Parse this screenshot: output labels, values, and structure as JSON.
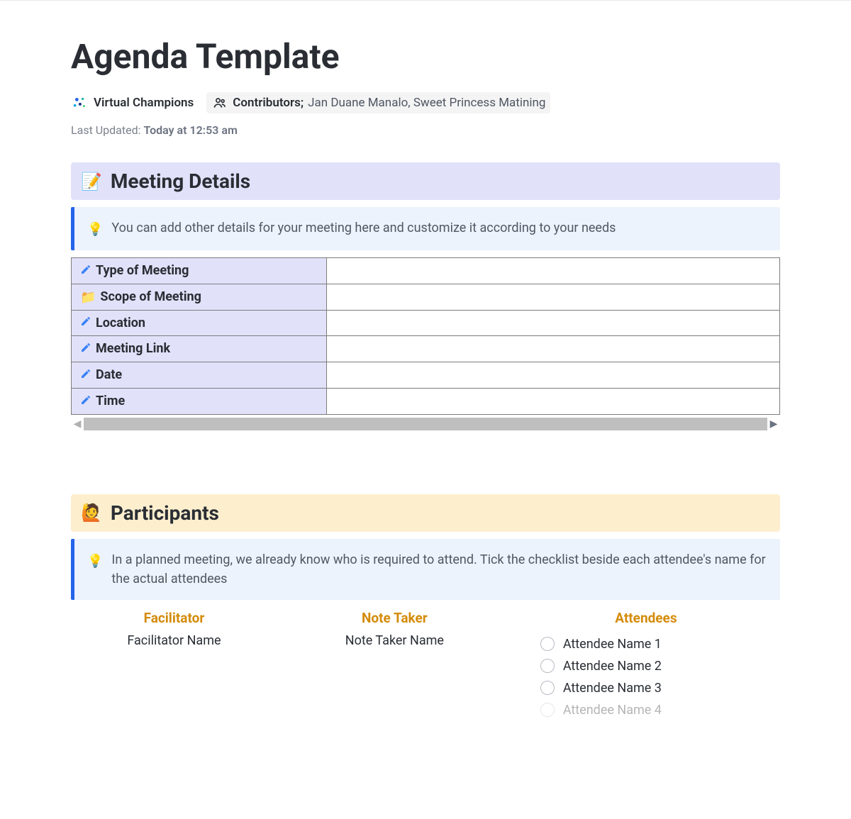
{
  "page": {
    "title": "Agenda Template"
  },
  "meta": {
    "team_name": "Virtual Champions",
    "contributors_label": "Contributors",
    "contributors_value": "Jan Duane Manalo, Sweet Princess Matining",
    "last_updated_label": "Last Updated:",
    "last_updated_value": "Today at 12:53 am"
  },
  "sections": {
    "meeting_details": {
      "title": "Meeting Details",
      "info": "You can add other details for your meeting here and customize it according to your needs",
      "rows": [
        {
          "label": "Type of Meeting",
          "value": "",
          "icon": "pencil"
        },
        {
          "label": "Scope of Meeting",
          "value": "",
          "icon": "folder"
        },
        {
          "label": "Location",
          "value": "",
          "icon": "pencil"
        },
        {
          "label": "Meeting Link",
          "value": "",
          "icon": "pencil"
        },
        {
          "label": "Date",
          "value": "",
          "icon": "pencil"
        },
        {
          "label": "Time",
          "value": "",
          "icon": "pencil"
        }
      ]
    },
    "participants": {
      "title": "Participants",
      "info": "In a planned meeting, we already know who is required to attend. Tick the checklist beside each attendee's name for the actual attendees",
      "columns": {
        "facilitator": {
          "heading": "Facilitator",
          "value": "Facilitator Name"
        },
        "note_taker": {
          "heading": "Note Taker",
          "value": "Note Taker Name"
        },
        "attendees": {
          "heading": "Attendees",
          "items": [
            {
              "name": "Attendee Name 1",
              "checked": false
            },
            {
              "name": "Attendee Name 2",
              "checked": false
            },
            {
              "name": "Attendee Name 3",
              "checked": false
            },
            {
              "name": "Attendee Name 4",
              "checked": false
            }
          ]
        }
      }
    }
  },
  "icons": {
    "memo_emoji": "📝",
    "raise_hand_emoji": "🙋",
    "bulb_emoji": "💡",
    "folder_emoji": "📁"
  }
}
